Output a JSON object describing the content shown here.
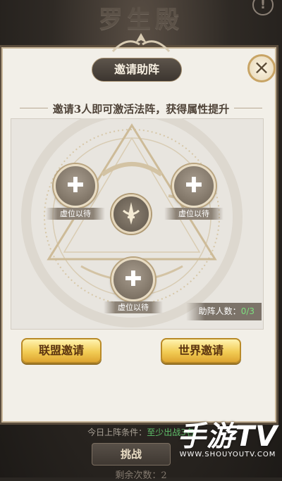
{
  "background": {
    "hall_title": "罗生殿",
    "info_icon": "!",
    "condition_prefix": "今日上阵条件：",
    "condition_value": "至少出战3名",
    "challenge_label": "挑战",
    "remaining_label": "剩余次数：2"
  },
  "dialog": {
    "title": "邀请助阵",
    "close_icon": "close-icon",
    "subtitle": "邀请3人即可激活法阵，获得属性提升",
    "slots": [
      {
        "label": "虚位以待"
      },
      {
        "label": "虚位以待"
      },
      {
        "label": "虚位以待"
      }
    ],
    "helper_count_label": "助阵人数：",
    "helper_count_value": "0/3",
    "alliance_invite_label": "联盟邀请",
    "world_invite_label": "世界邀请"
  },
  "watermark": {
    "big": "手游TV",
    "small": "WWW.SHOUYOUTV.COM"
  },
  "colors": {
    "dialog_bg": "#f2efe8",
    "gold_button": "#f2cc55",
    "count_highlight": "#7de07f",
    "condition_highlight": "#5fbf6a"
  }
}
